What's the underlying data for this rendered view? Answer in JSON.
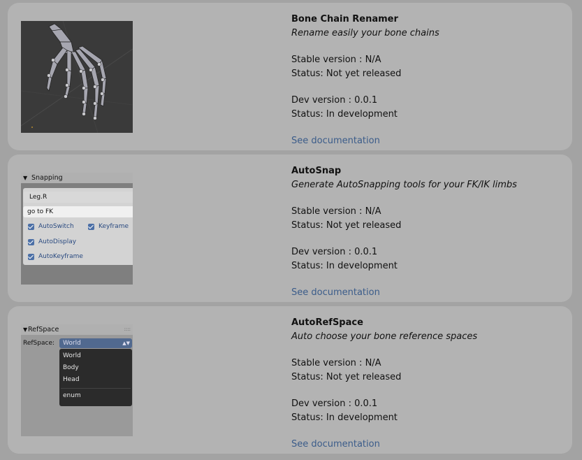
{
  "addons": [
    {
      "title": "Bone Chain Renamer",
      "subtitle": "Rename easily your bone chains",
      "stable_version": "Stable version : N/A",
      "stable_status": "Status: Not yet released",
      "dev_version": "Dev version : 0.0.1",
      "dev_status": "Status: In development",
      "doc_link": "See documentation",
      "image": "bone-hand-viewport"
    },
    {
      "title": "AutoSnap",
      "subtitle": "Generate AutoSnapping tools for your FK/IK limbs",
      "stable_version": "Stable version : N/A",
      "stable_status": "Status: Not yet released",
      "dev_version": "Dev version : 0.0.1",
      "dev_status": "Status: In development",
      "doc_link": "See documentation",
      "image": "snapping-panel"
    },
    {
      "title": "AutoRefSpace",
      "subtitle": "Auto choose your bone reference spaces",
      "stable_version": "Stable version : N/A",
      "stable_status": "Status: Not yet released",
      "dev_version": "Dev version : 0.0.1",
      "dev_status": "Status: In development",
      "doc_link": "See documentation",
      "image": "refspace-panel"
    }
  ],
  "snapping_panel": {
    "header": "Snapping",
    "field1": "Leg.R",
    "field2": "go to FK",
    "cb_autoswitch": "AutoSwitch",
    "cb_keyframe": "Keyframe",
    "cb_autodisplay": "AutoDisplay",
    "cb_autokeyframe": "AutoKeyframe"
  },
  "refspace_panel": {
    "header": "RefSpace",
    "label": "RefSpace:",
    "selected": "World",
    "options": [
      "World",
      "Body",
      "Head"
    ],
    "footer": "enum"
  },
  "colors": {
    "page_bg": "#a3a3a3",
    "card_bg": "#b3b3b3",
    "link": "#3b5c8a"
  }
}
